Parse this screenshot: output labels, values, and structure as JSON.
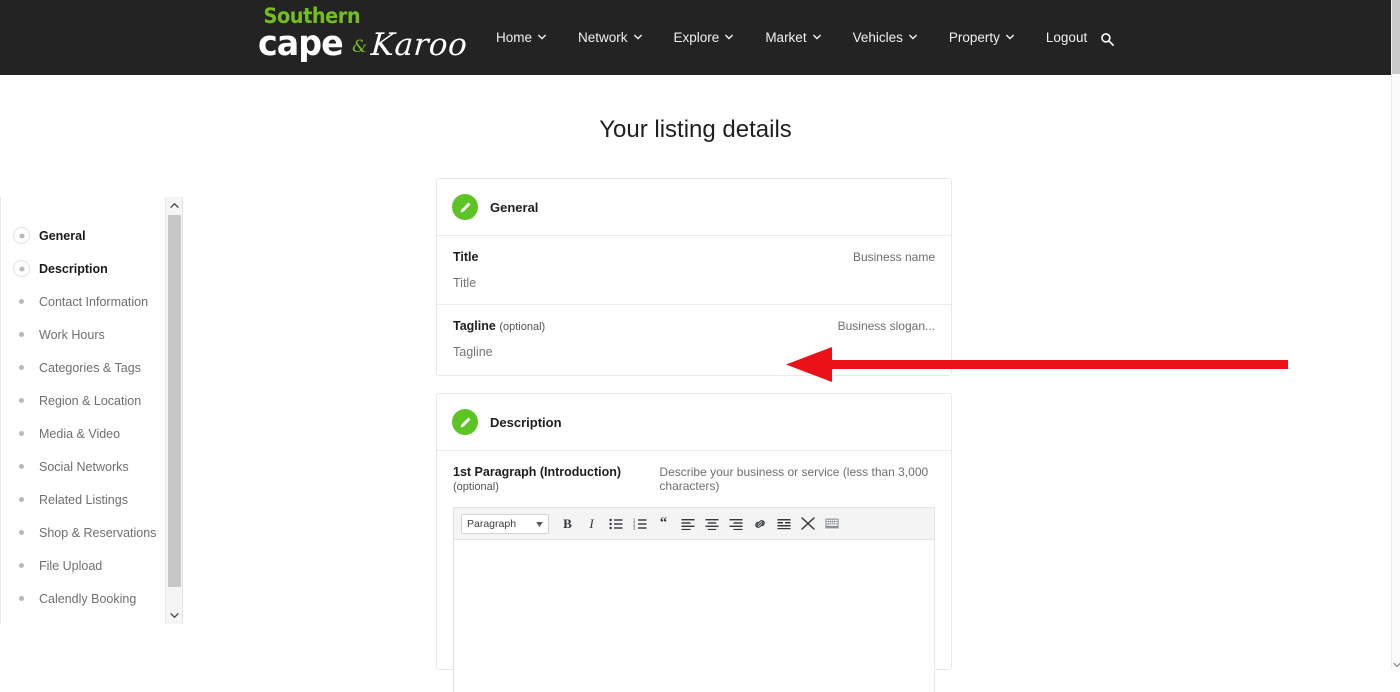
{
  "header": {
    "logo": {
      "line1": "Southern",
      "word1": "cape",
      "amp": "&",
      "word2": "Karoo",
      "color_green": "#76bd21",
      "color_white": "#ffffff",
      "bg": "#232323"
    },
    "nav": [
      {
        "label": "Home",
        "has_chevron": true,
        "icon": "chevron-down-icon"
      },
      {
        "label": "Network",
        "has_chevron": true,
        "icon": "chevron-down-icon"
      },
      {
        "label": "Explore",
        "has_chevron": true,
        "icon": "chevron-down-icon"
      },
      {
        "label": "Market",
        "has_chevron": true,
        "icon": "chevron-down-icon"
      },
      {
        "label": "Vehicles",
        "has_chevron": true,
        "icon": "chevron-down-icon"
      },
      {
        "label": "Property",
        "has_chevron": true,
        "icon": "chevron-down-icon"
      },
      {
        "label": "Logout",
        "has_chevron": false,
        "icon": ""
      }
    ],
    "search_icon": "search-icon"
  },
  "page": {
    "title": "Your listing details"
  },
  "sidebar": {
    "scroll_up_icon": "chevron-up-icon",
    "scroll_down_icon": "chevron-down-icon",
    "items": [
      {
        "label": "General",
        "active": true
      },
      {
        "label": "Description",
        "active": true
      },
      {
        "label": "Contact Information",
        "active": false
      },
      {
        "label": "Work Hours",
        "active": false
      },
      {
        "label": "Categories & Tags",
        "active": false
      },
      {
        "label": "Region & Location",
        "active": false
      },
      {
        "label": "Media & Video",
        "active": false
      },
      {
        "label": "Social Networks",
        "active": false
      },
      {
        "label": "Related Listings",
        "active": false
      },
      {
        "label": "Shop & Reservations",
        "active": false
      },
      {
        "label": "File Upload",
        "active": false
      },
      {
        "label": "Calendly Booking",
        "active": false
      }
    ]
  },
  "general_card": {
    "icon": "pencil-icon",
    "icon_color": "#5cc425",
    "heading": "General",
    "fields": [
      {
        "label": "Title",
        "optional_text": "",
        "hint": "Business name",
        "placeholder": "Title",
        "value": ""
      },
      {
        "label": "Tagline",
        "optional_text": "(optional)",
        "hint": "Business slogan...",
        "placeholder": "Tagline",
        "value": ""
      }
    ]
  },
  "description_card": {
    "icon": "pencil-icon",
    "icon_color": "#5cc425",
    "heading": "Description",
    "field_label": "1st Paragraph (Introduction)",
    "field_optional": "(optional)",
    "field_hint": "Describe your business or service (less than 3,000 characters)",
    "editor": {
      "format_select": {
        "value": "Paragraph",
        "caret_icon": "triangle-down-icon"
      },
      "buttons": [
        {
          "name": "bold-icon",
          "label": "B"
        },
        {
          "name": "italic-icon",
          "label": "I"
        },
        {
          "name": "bullet-list-icon",
          "label": ""
        },
        {
          "name": "numbered-list-icon",
          "label": ""
        },
        {
          "name": "blockquote-icon",
          "label": "“"
        },
        {
          "name": "align-left-icon",
          "label": ""
        },
        {
          "name": "align-center-icon",
          "label": ""
        },
        {
          "name": "align-right-icon",
          "label": ""
        },
        {
          "name": "link-icon",
          "label": ""
        },
        {
          "name": "read-more-icon",
          "label": ""
        },
        {
          "name": "fullscreen-icon",
          "label": ""
        },
        {
          "name": "keyboard-shortcuts-icon",
          "label": ""
        }
      ],
      "content": ""
    }
  },
  "annotation": {
    "type": "arrow-left",
    "color": "#ea1118"
  }
}
